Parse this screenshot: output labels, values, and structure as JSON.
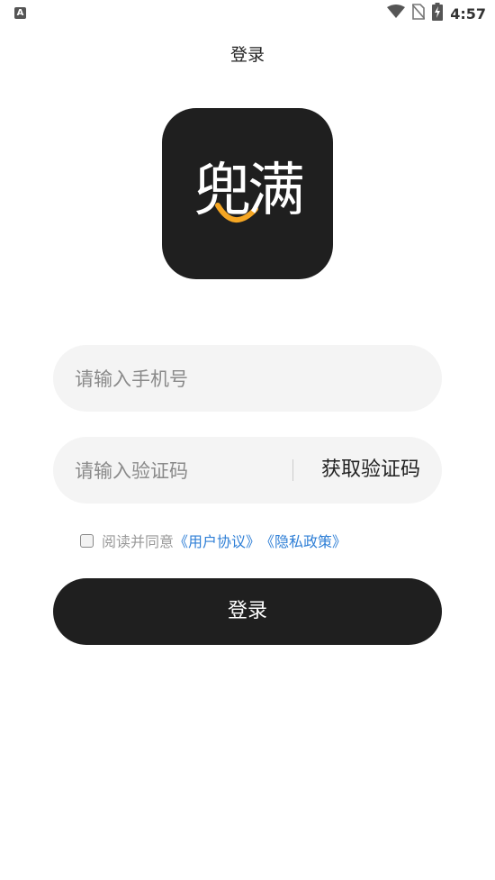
{
  "status_bar": {
    "notification_icon": "A",
    "time": "4:57",
    "icons": [
      "wifi-icon",
      "no-sim-icon",
      "battery-charging-icon"
    ]
  },
  "header": {
    "title": "登录"
  },
  "logo": {
    "text": "兜满",
    "icon": "app-logo"
  },
  "form": {
    "phone_placeholder": "请输入手机号",
    "phone_value": "",
    "code_placeholder": "请输入验证码",
    "code_value": "",
    "get_code_label": "获取验证码"
  },
  "agreement": {
    "checked": false,
    "text": "阅读并同意",
    "user_agreement": "《用户协议》",
    "privacy_policy": "《隐私政策》"
  },
  "login_button": {
    "label": "登录"
  },
  "colors": {
    "primary_dark": "#1f1f1f",
    "input_bg": "#f4f4f4",
    "link": "#2f7fd6",
    "accent_orange": "#f5a623"
  }
}
